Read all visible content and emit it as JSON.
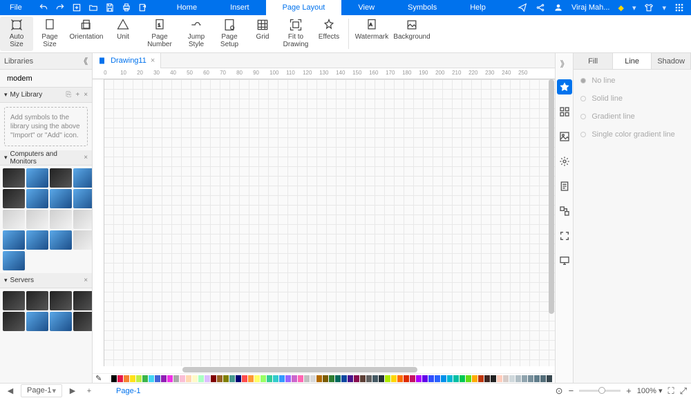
{
  "menubar": {
    "file": "File",
    "tabs": [
      "Home",
      "Insert",
      "Page Layout",
      "View",
      "Symbols",
      "Help"
    ],
    "active_tab": 2,
    "user": "Viraj Mah..."
  },
  "ribbon": [
    {
      "label": "Auto\nSize"
    },
    {
      "label": "Page\nSize",
      "dd": true
    },
    {
      "label": "Orientation",
      "dd": true
    },
    {
      "label": "Unit",
      "dd": true
    },
    {
      "label": "Page\nNumber",
      "dd": true
    },
    {
      "label": "Jump\nStyle",
      "dd": true
    },
    {
      "label": "Page\nSetup"
    },
    {
      "label": "Grid"
    },
    {
      "label": "Fit to\nDrawing"
    },
    {
      "label": "Effects",
      "dd": true
    },
    {
      "label": "Watermark",
      "dd": true
    },
    {
      "label": "Background",
      "dd": true
    }
  ],
  "libs": {
    "title": "Libraries",
    "search_value": "modem",
    "mylib": {
      "title": "My Library",
      "empty": "Add symbols to the library using the above \"Import\" or \"Add\" icon."
    },
    "computers": {
      "title": "Computers and Monitors"
    },
    "servers": {
      "title": "Servers"
    }
  },
  "doc": {
    "tab": "Drawing11",
    "ruler_marks": [
      0,
      10,
      20,
      30,
      40,
      50,
      60,
      70,
      80,
      90,
      100,
      110,
      120,
      130,
      140,
      150,
      160,
      170,
      180,
      190,
      200,
      210,
      220,
      230,
      240,
      250
    ]
  },
  "prop_tabs": [
    "Fill",
    "Line",
    "Shadow"
  ],
  "prop_active": 1,
  "line_opts": [
    "No line",
    "Solid line",
    "Gradient line",
    "Single color gradient line"
  ],
  "line_selected": 0,
  "status": {
    "page_name": "Page-1",
    "page_tab": "Page-1",
    "zoom": "100%"
  },
  "colors": [
    "#fff",
    "#000",
    "#e6194B",
    "#f58231",
    "#ffe119",
    "#bfef45",
    "#3cb44b",
    "#42d4f4",
    "#4363d8",
    "#911eb4",
    "#f032e6",
    "#a9a9a9",
    "#fabed4",
    "#ffd8b1",
    "#fffac8",
    "#aaffc3",
    "#dcbeff",
    "#800000",
    "#9A6324",
    "#808000",
    "#469990",
    "#000075",
    "#ff4d4d",
    "#ff9933",
    "#ffff66",
    "#99ff66",
    "#33cc99",
    "#33cccc",
    "#3399ff",
    "#9966ff",
    "#cc66cc",
    "#ff66b3",
    "#c0c0c0",
    "#d9d9d9",
    "#b36b00",
    "#7a5c00",
    "#2e7d32",
    "#00695c",
    "#0d47a1",
    "#4a148c",
    "#880e4f",
    "#5d4037",
    "#616161",
    "#455a64",
    "#263238",
    "#aeea00",
    "#ffd600",
    "#ff6d00",
    "#dd2c00",
    "#c51162",
    "#aa00ff",
    "#6200ea",
    "#304ffe",
    "#2962ff",
    "#0091ea",
    "#00b8d4",
    "#00bfa5",
    "#00c853",
    "#64dd17",
    "#ffab00",
    "#bf360c",
    "#3e2723",
    "#212121",
    "#ffccbc",
    "#d7ccc8",
    "#cfd8dc",
    "#b0bec5",
    "#90a4ae",
    "#78909c",
    "#607d8b",
    "#546e7a",
    "#37474f"
  ]
}
